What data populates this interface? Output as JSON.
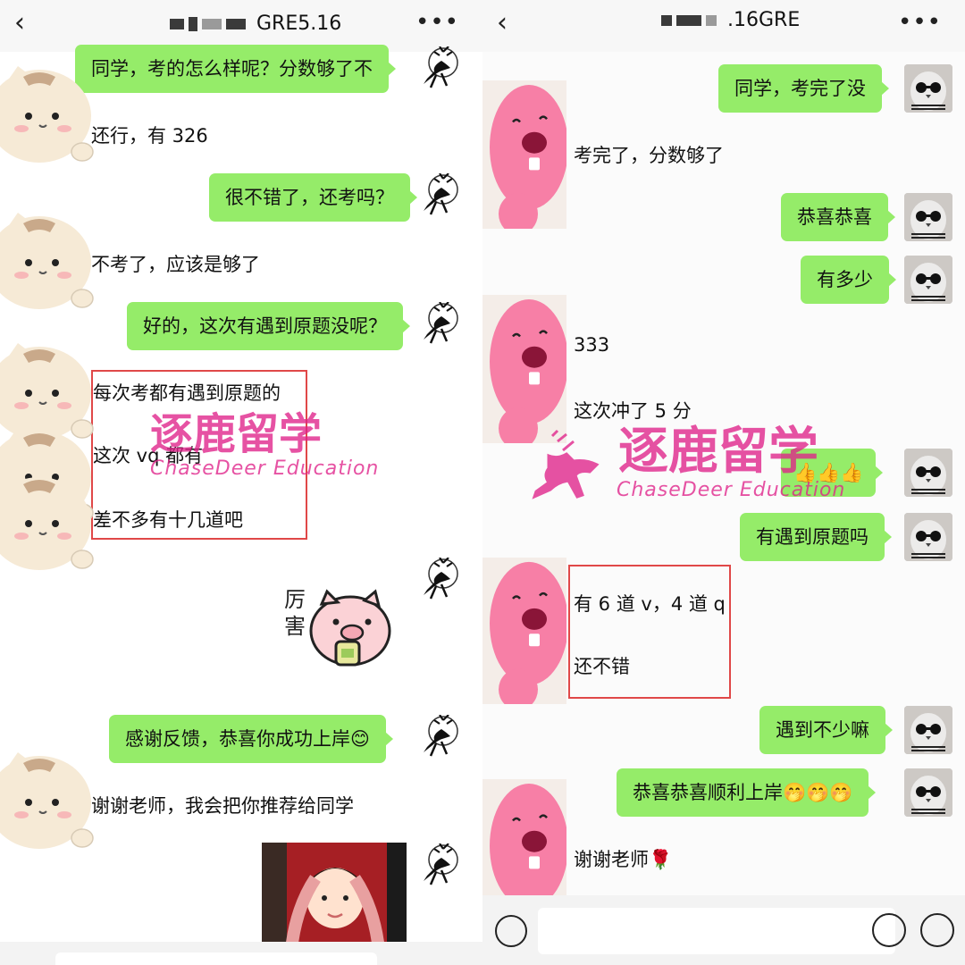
{
  "left_chat": {
    "title": "GRE5.16",
    "back_icon": "back-chevron-icon",
    "more_icon": "more-dots-icon",
    "messages": [
      {
        "from": "teacher",
        "text": "同学，考的怎么样呢？分数够了不"
      },
      {
        "from": "student",
        "text": "还行，有 326"
      },
      {
        "from": "teacher",
        "text": "很不错了，还考吗？"
      },
      {
        "from": "student",
        "text": "不考了，应该是够了"
      },
      {
        "from": "teacher",
        "text": "好的，这次有遇到原题没呢？"
      },
      {
        "from": "student",
        "text": "每次考都有遇到原题的"
      },
      {
        "from": "student",
        "text": "这次 vq 都有"
      },
      {
        "from": "student",
        "text": "差不多有十几道吧"
      },
      {
        "from": "teacher",
        "sticker": "pig-sticker",
        "text": "厉害"
      },
      {
        "from": "teacher",
        "text": "感谢反馈，恭喜你成功上岸😊"
      },
      {
        "from": "student",
        "text": "谢谢老师，我会把你推荐给同学"
      },
      {
        "from": "teacher",
        "image": "child-photo"
      }
    ]
  },
  "right_chat": {
    "title": ".16GRE",
    "back_icon": "back-chevron-icon",
    "more_icon": "more-dots-icon",
    "messages": [
      {
        "from": "teacher",
        "text": "同学，考完了没"
      },
      {
        "from": "student",
        "text": "考完了，分数够了"
      },
      {
        "from": "teacher",
        "text": "恭喜恭喜"
      },
      {
        "from": "teacher",
        "text": "有多少"
      },
      {
        "from": "student",
        "text": "333"
      },
      {
        "from": "student",
        "text": "这次冲了 5 分"
      },
      {
        "from": "teacher",
        "text": "👍👍👍"
      },
      {
        "from": "teacher",
        "text": "有遇到原题吗"
      },
      {
        "from": "student",
        "text": "有 6 道 v，4 道 q"
      },
      {
        "from": "student",
        "text": "还不错"
      },
      {
        "from": "teacher",
        "text": "遇到不少嘛"
      },
      {
        "from": "teacher",
        "text": "恭喜恭喜顺利上岸🤭🤭🤭"
      },
      {
        "from": "student",
        "text": "谢谢老师🌹"
      }
    ],
    "bottom_icons": [
      "voice-icon",
      "emoji-icon",
      "add-icon"
    ]
  },
  "watermark": {
    "brand": "逐鹿留学",
    "brand_en": "ChaseDeer Education",
    "color": "#e0228a"
  },
  "colors": {
    "bubble_green": "#95ec69",
    "highlight_box": "#e04848"
  }
}
